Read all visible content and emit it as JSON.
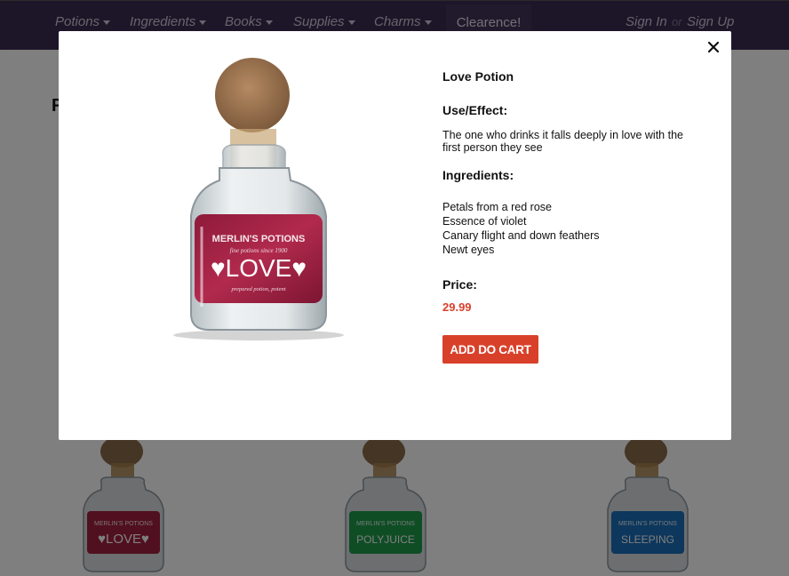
{
  "nav": {
    "items": [
      {
        "label": "Potions"
      },
      {
        "label": "Ingredients"
      },
      {
        "label": "Books"
      },
      {
        "label": "Supplies"
      },
      {
        "label": "Charms"
      }
    ],
    "clearance": "Clearence!",
    "sign_in": "Sign In",
    "or": "or",
    "sign_up": "Sign Up"
  },
  "page": {
    "heading_partial": "F"
  },
  "background_products": [
    {
      "brand": "MERLIN'S POTIONS",
      "name": "♥LOVE♥",
      "color": "#a3203f"
    },
    {
      "brand": "MERLIN'S POTIONS",
      "name": "POLYJUICE",
      "color": "#1f9a4a"
    },
    {
      "brand": "MERLIN'S POTIONS",
      "name": "SLEEPING",
      "color": "#1a6fb8"
    }
  ],
  "modal": {
    "product_name": "Love Potion",
    "use_label": "Use/Effect:",
    "use_text": "The one who drinks it falls deeply in love with the first person they see",
    "ingredients_label": "Ingredients:",
    "ingredients": [
      "Petals from a red rose",
      "Essence of violet",
      "Canary flight and down feathers",
      "Newt eyes"
    ],
    "price_label": "Price:",
    "price": "29.99",
    "add_to_cart": "ADD DO CART",
    "image": {
      "brand": "MERLIN'S POTIONS",
      "tagline": "fine potions since 1900",
      "name": "♥LOVE♥",
      "sub": "prepared potion, potent"
    }
  },
  "colors": {
    "nav_bg": "#3b2c50",
    "accent_red": "#d9402a",
    "label_crimson": "#a3203f"
  }
}
